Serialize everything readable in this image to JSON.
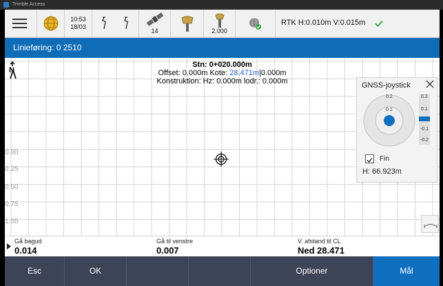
{
  "window": {
    "title": "Trimble Access"
  },
  "status": {
    "time": "10:53",
    "date": "18/03",
    "satellites": "14",
    "antenna_height": "2.000",
    "rtk": "RTK H:0.010m V:0.015m"
  },
  "header": {
    "title": "Linieføring: 0 2510"
  },
  "map": {
    "north_label": "N",
    "station": "Stn: 0+020.000m",
    "offset_prefix": "Offset: 0.000m Kote: ",
    "kote_value": "28.471m",
    "offset_suffix": "|0.000m",
    "construction": "Konstruktion: Hz: 0.000m lodr.: 0.000m",
    "scale_labels": [
      "0.00",
      "0.25",
      "0.50",
      "0.75",
      "1.00"
    ]
  },
  "joystick": {
    "title": "GNSS-joystick",
    "ring_labels": [
      "0.2",
      "0.1"
    ],
    "scale": [
      "0.2",
      "0.1",
      "-0.1",
      "-0.2"
    ],
    "fine_label": "Fin",
    "fine_checked": true,
    "height": "H: 66.923m"
  },
  "data": {
    "col1": {
      "label": "Gå bagud",
      "value": "0.014"
    },
    "col2": {
      "label": "Gå til venstre",
      "value": "0.007"
    },
    "col3": {
      "label": "V. afstand til CL",
      "value": "Ned 28.471"
    }
  },
  "softkeys": {
    "esc": "Esc",
    "ok": "OK",
    "options": "Optioner",
    "measure": "Mål"
  },
  "colors": {
    "accent": "#0f6cb6",
    "softkey_bg": "#3d4457",
    "check_green": "#3aa84a"
  }
}
